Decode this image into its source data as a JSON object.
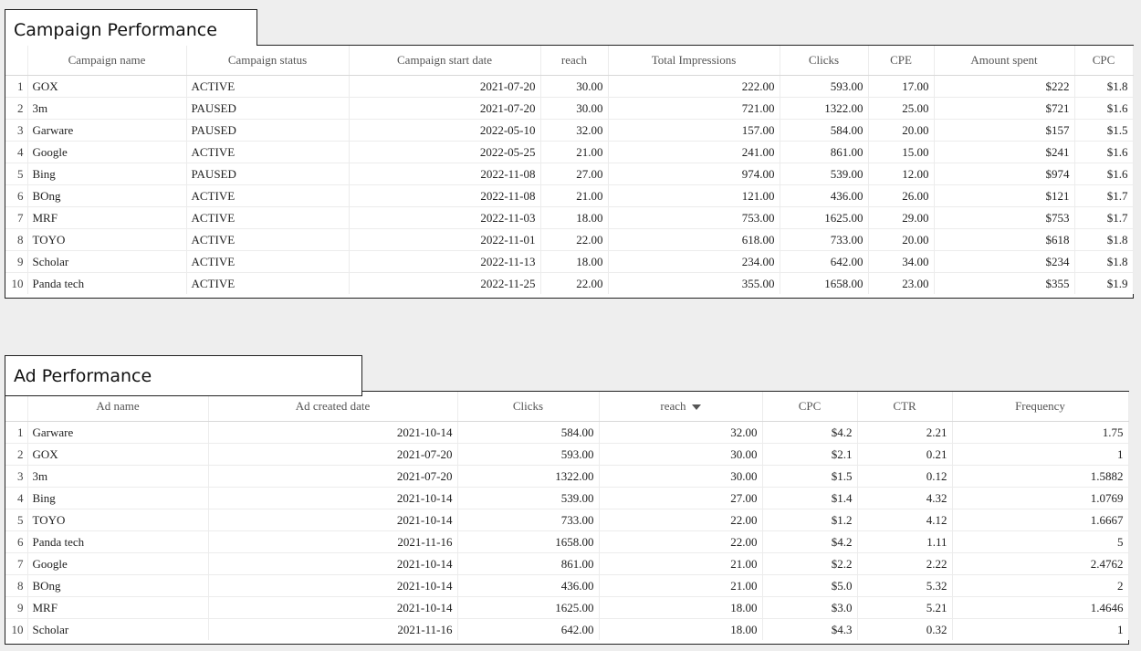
{
  "campaign_performance": {
    "title": "Campaign Performance",
    "columns": [
      "Campaign name",
      "Campaign status",
      "Campaign start date",
      "reach",
      "Total Impressions",
      "Clicks",
      "CPE",
      "Amount spent",
      "CPC"
    ],
    "rows": [
      [
        "1",
        "GOX",
        "ACTIVE",
        "2021-07-20",
        "30.00",
        "222.00",
        "593.00",
        "17.00",
        "$222",
        "$1.8"
      ],
      [
        "2",
        "3m",
        "PAUSED",
        "2021-07-20",
        "30.00",
        "721.00",
        "1322.00",
        "25.00",
        "$721",
        "$1.6"
      ],
      [
        "3",
        "Garware",
        "PAUSED",
        "2022-05-10",
        "32.00",
        "157.00",
        "584.00",
        "20.00",
        "$157",
        "$1.5"
      ],
      [
        "4",
        "Google",
        "ACTIVE",
        "2022-05-25",
        "21.00",
        "241.00",
        "861.00",
        "15.00",
        "$241",
        "$1.6"
      ],
      [
        "5",
        "Bing",
        "PAUSED",
        "2022-11-08",
        "27.00",
        "974.00",
        "539.00",
        "12.00",
        "$974",
        "$1.6"
      ],
      [
        "6",
        "BOng",
        "ACTIVE",
        "2022-11-08",
        "21.00",
        "121.00",
        "436.00",
        "26.00",
        "$121",
        "$1.7"
      ],
      [
        "7",
        "MRF",
        "ACTIVE",
        "2022-11-03",
        "18.00",
        "753.00",
        "1625.00",
        "29.00",
        "$753",
        "$1.7"
      ],
      [
        "8",
        "TOYO",
        "ACTIVE",
        "2022-11-01",
        "22.00",
        "618.00",
        "733.00",
        "20.00",
        "$618",
        "$1.8"
      ],
      [
        "9",
        "Scholar",
        "ACTIVE",
        "2022-11-13",
        "18.00",
        "234.00",
        "642.00",
        "34.00",
        "$234",
        "$1.8"
      ],
      [
        "10",
        "Panda tech",
        "ACTIVE",
        "2022-11-25",
        "22.00",
        "355.00",
        "1658.00",
        "23.00",
        "$355",
        "$1.9"
      ]
    ]
  },
  "ad_performance": {
    "title": "Ad Performance",
    "columns": [
      "Ad name",
      "Ad created date",
      "Clicks",
      "reach",
      "CPC",
      "CTR",
      "Frequency"
    ],
    "sorted_column": "reach",
    "rows": [
      [
        "1",
        "Garware",
        "2021-10-14",
        "584.00",
        "32.00",
        "$4.2",
        "2.21",
        "1.75"
      ],
      [
        "2",
        "GOX",
        "2021-07-20",
        "593.00",
        "30.00",
        "$2.1",
        "0.21",
        "1"
      ],
      [
        "3",
        "3m",
        "2021-07-20",
        "1322.00",
        "30.00",
        "$1.5",
        "0.12",
        "1.5882"
      ],
      [
        "4",
        "Bing",
        "2021-10-14",
        "539.00",
        "27.00",
        "$1.4",
        "4.32",
        "1.0769"
      ],
      [
        "5",
        "TOYO",
        "2021-10-14",
        "733.00",
        "22.00",
        "$1.2",
        "4.12",
        "1.6667"
      ],
      [
        "6",
        "Panda tech",
        "2021-11-16",
        "1658.00",
        "22.00",
        "$4.2",
        "1.11",
        "5"
      ],
      [
        "7",
        "Google",
        "2021-10-14",
        "861.00",
        "21.00",
        "$2.2",
        "2.22",
        "2.4762"
      ],
      [
        "8",
        "BOng",
        "2021-10-14",
        "436.00",
        "21.00",
        "$5.0",
        "5.32",
        "2"
      ],
      [
        "9",
        "MRF",
        "2021-10-14",
        "1625.00",
        "18.00",
        "$3.0",
        "5.21",
        "1.4646"
      ],
      [
        "10",
        "Scholar",
        "2021-11-16",
        "642.00",
        "18.00",
        "$4.3",
        "0.32",
        "1"
      ]
    ]
  }
}
